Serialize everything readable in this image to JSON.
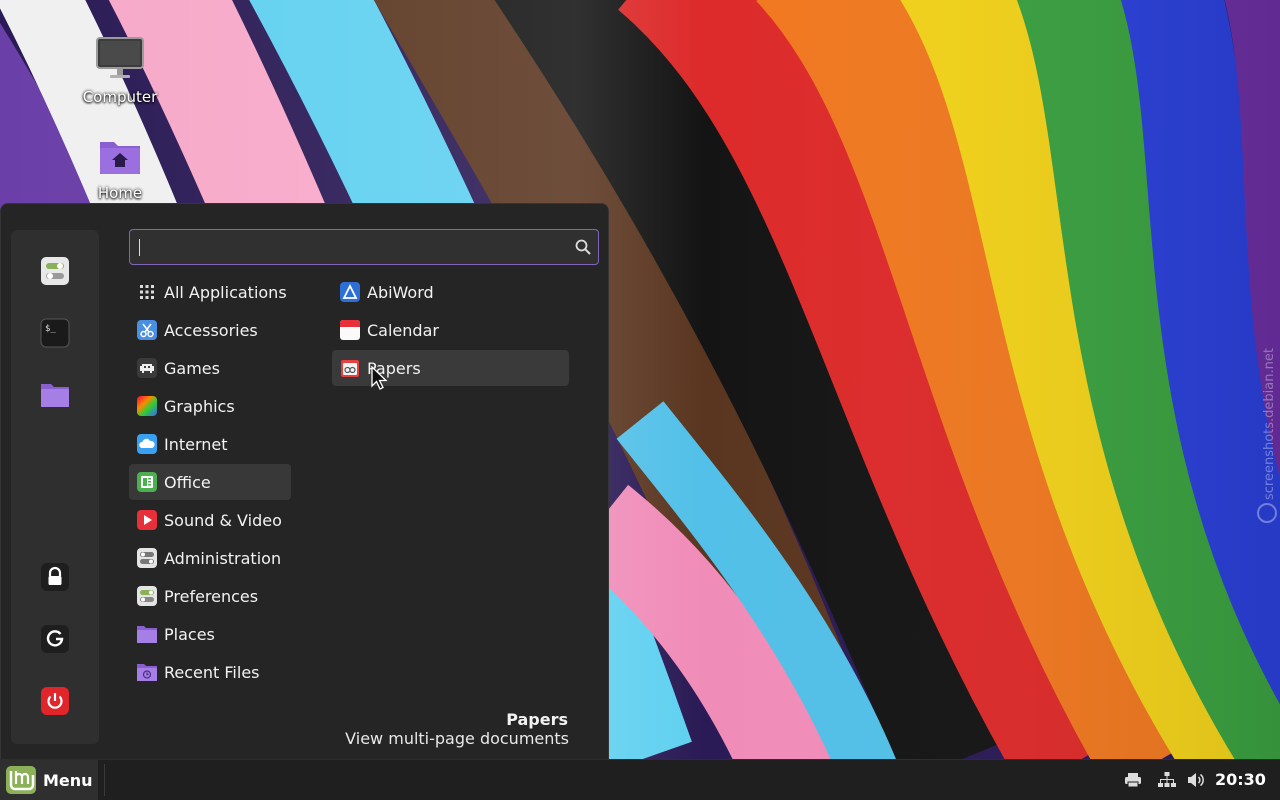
{
  "desktop": {
    "icons": [
      {
        "label": "Computer"
      },
      {
        "label": "Home"
      }
    ],
    "watermark": "screenshots.debian.net"
  },
  "menu": {
    "search": {
      "value": "",
      "placeholder": ""
    },
    "favorites": [
      "settings-toggle-icon",
      "terminal-icon",
      "folder-icon"
    ],
    "session": [
      "lock-icon",
      "logout-icon",
      "power-icon"
    ],
    "categories": [
      {
        "label": "All Applications",
        "icon": "grid-icon"
      },
      {
        "label": "Accessories",
        "icon": "scissors-icon"
      },
      {
        "label": "Games",
        "icon": "invader-icon"
      },
      {
        "label": "Graphics",
        "icon": "gradient-icon"
      },
      {
        "label": "Internet",
        "icon": "cloud-icon"
      },
      {
        "label": "Office",
        "icon": "office-icon",
        "selected": true
      },
      {
        "label": "Sound & Video",
        "icon": "play-icon"
      },
      {
        "label": "Administration",
        "icon": "toggle-icon"
      },
      {
        "label": "Preferences",
        "icon": "preferences-icon"
      },
      {
        "label": "Places",
        "icon": "folder-icon"
      },
      {
        "label": "Recent Files",
        "icon": "recent-folder-icon"
      }
    ],
    "apps": [
      {
        "label": "AbiWord",
        "icon": "abiword-icon"
      },
      {
        "label": "Calendar",
        "icon": "calendar-icon"
      },
      {
        "label": "Papers",
        "icon": "papers-icon",
        "hovered": true
      }
    ],
    "description": {
      "title": "Papers",
      "text": "View multi-page documents"
    }
  },
  "taskbar": {
    "menu_label": "Menu",
    "tray": [
      "printer-icon",
      "network-icon",
      "volume-icon"
    ],
    "clock": "20:30"
  },
  "colors": {
    "menu_bg": "#252525",
    "accent": "#7f66b8",
    "mint_green": "#8bb158",
    "power_red": "#e0252b"
  }
}
